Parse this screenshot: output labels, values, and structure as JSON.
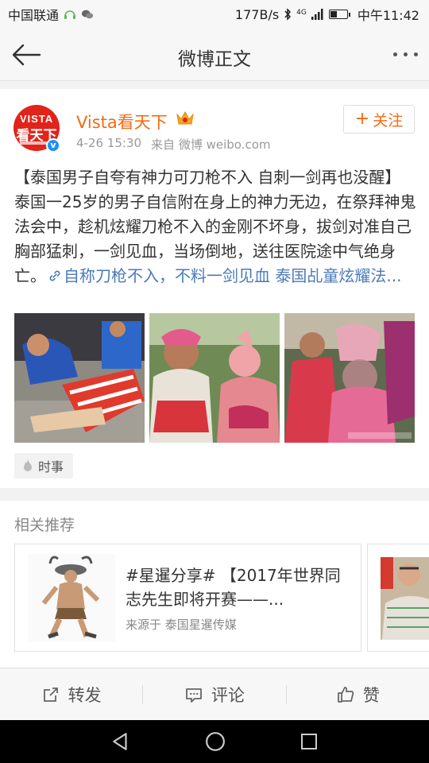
{
  "status_bar": {
    "carrier": "中国联通",
    "network_speed": "177B/s",
    "network_type": "4G",
    "time": "中午11:42"
  },
  "nav": {
    "title": "微博正文"
  },
  "post": {
    "username": "Vista看天下",
    "avatar_text_top": "VISTA",
    "avatar_text_main": "看天下",
    "date": "4-26 15:30",
    "source": "来自 微博 weibo.com",
    "follow_label": "关注",
    "text_main": "【泰国男子自夸有神力可刀枪不入 自刺一剑再也没醒】泰国一25岁的男子自信附在身上的神力无边，在祭拜神鬼法会中，趁机炫耀刀枪不入的金刚不坏身，拔剑对准自己胸部猛刺，一剑见血，当场倒地，送往医院途中气绝身亡。",
    "text_link": "自称刀枪不入，不料一剑见血 泰国乩童炫耀法...",
    "topic_tag": "时事"
  },
  "related": {
    "title": "相关推荐",
    "cards": [
      {
        "title": "#星暹分享# 【2017年世界同志先生即将开赛——...",
        "source": "来源于 泰国星暹传媒"
      }
    ]
  },
  "actions": {
    "repost": "转发",
    "comment": "评论",
    "like": "赞"
  },
  "colors": {
    "brand_orange": "#f26b13",
    "link_blue": "#4a7ab8",
    "verified_blue": "#1e90ff",
    "avatar_red": "#e2231a"
  }
}
